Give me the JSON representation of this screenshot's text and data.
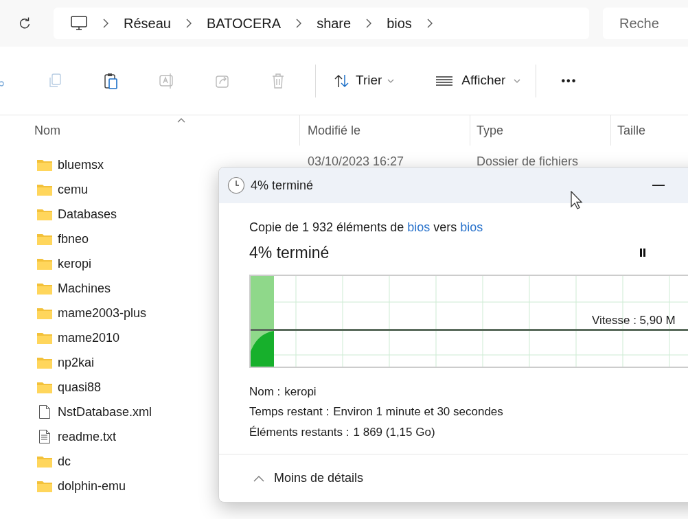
{
  "breadcrumb": [
    "Réseau",
    "BATOCERA",
    "share",
    "bios"
  ],
  "search": {
    "placeholder": "Reche"
  },
  "toolbar": {
    "sort": "Trier",
    "view": "Afficher",
    "more": "•••"
  },
  "columns": [
    "Nom",
    "Modifié le",
    "Type",
    "Taille"
  ],
  "files": [
    {
      "name": "bluemsx",
      "kind": "folder",
      "modified": "03/10/2023 16:27",
      "type": "Dossier de fichiers"
    },
    {
      "name": "cemu",
      "kind": "folder"
    },
    {
      "name": "Databases",
      "kind": "folder"
    },
    {
      "name": "fbneo",
      "kind": "folder"
    },
    {
      "name": "keropi",
      "kind": "folder"
    },
    {
      "name": "Machines",
      "kind": "folder"
    },
    {
      "name": "mame2003-plus",
      "kind": "folder"
    },
    {
      "name": "mame2010",
      "kind": "folder"
    },
    {
      "name": "np2kai",
      "kind": "folder"
    },
    {
      "name": "quasi88",
      "kind": "folder"
    },
    {
      "name": "NstDatabase.xml",
      "kind": "file"
    },
    {
      "name": "readme.txt",
      "kind": "text"
    },
    {
      "name": "dc",
      "kind": "folder"
    },
    {
      "name": "dolphin-emu",
      "kind": "folder"
    }
  ],
  "dialog": {
    "title": "4% terminé",
    "summary": "Copie de 1 932 éléments de",
    "source": "bios",
    "joiner": "vers",
    "destination": "bios",
    "heading": "4% terminé",
    "speed": "Vitesse : 5,90 M",
    "details": [
      {
        "label": "Nom :",
        "value": "keropi"
      },
      {
        "label": "Temps restant :",
        "value": "Environ 1 minute et 30 secondes"
      },
      {
        "label": "Éléments restants :",
        "value": "1 869 (1,15 Go)"
      }
    ],
    "toggle": "Moins de détails"
  }
}
